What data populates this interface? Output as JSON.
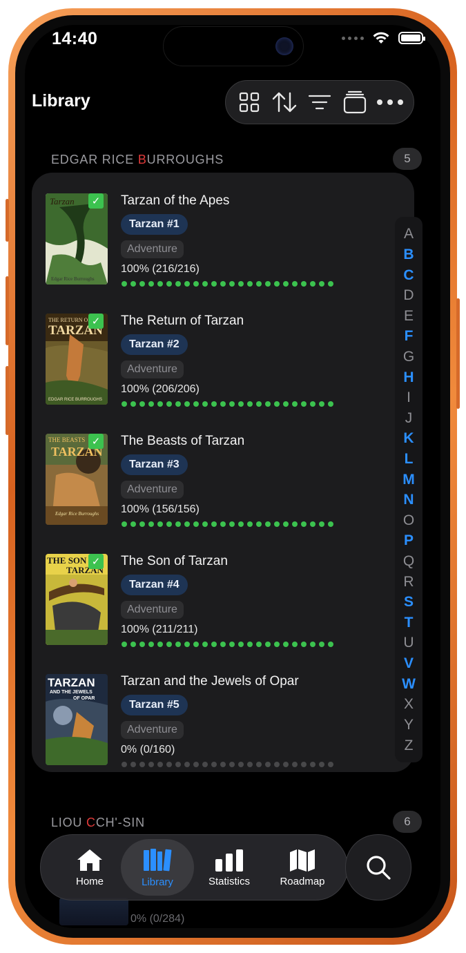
{
  "status": {
    "time": "14:40"
  },
  "header": {
    "title": "Library"
  },
  "toolbar": {
    "icons": [
      "grid-icon",
      "sort-icon",
      "filter-icon",
      "stack-icon",
      "more-icon"
    ]
  },
  "sections": [
    {
      "name_pre": "EDGAR RICE ",
      "name_hl": "B",
      "name_post": "URROUGHS",
      "count": "5"
    },
    {
      "name_pre": "LIOU ",
      "name_hl": "C",
      "name_post": "CH'-SIN",
      "count": "6"
    }
  ],
  "books": [
    {
      "title": "Tarzan of the Apes",
      "series": "Tarzan #1",
      "genre": "Adventure",
      "progress": "100% (216/216)",
      "progress_fraction": 1.0,
      "finished": true,
      "cover_text": "Tarzan"
    },
    {
      "title": "The Return of Tarzan",
      "series": "Tarzan #2",
      "genre": "Adventure",
      "progress": "100% (206/206)",
      "progress_fraction": 1.0,
      "finished": true,
      "cover_text": "THE RETURN OF TARZAN"
    },
    {
      "title": "The Beasts of Tarzan",
      "series": "Tarzan #3",
      "genre": "Adventure",
      "progress": "100% (156/156)",
      "progress_fraction": 1.0,
      "finished": true,
      "cover_text": "THE BEASTS OF TARZAN"
    },
    {
      "title": "The Son of Tarzan",
      "series": "Tarzan #4",
      "genre": "Adventure",
      "progress": "100% (211/211)",
      "progress_fraction": 1.0,
      "finished": true,
      "cover_text": "THE SON OF TARZAN"
    },
    {
      "title": "Tarzan and the Jewels of Opar",
      "series": "Tarzan #5",
      "genre": "Adventure",
      "progress": "0% (0/160)",
      "progress_fraction": 0.0,
      "finished": false,
      "cover_text": "TARZAN AND THE JEWELS OF OPAR"
    }
  ],
  "below": {
    "progress": "0% (0/284)"
  },
  "alphabet": [
    "A",
    "B",
    "C",
    "D",
    "E",
    "F",
    "G",
    "H",
    "I",
    "J",
    "K",
    "L",
    "M",
    "N",
    "O",
    "P",
    "Q",
    "R",
    "S",
    "T",
    "U",
    "V",
    "W",
    "X",
    "Y",
    "Z"
  ],
  "alphabet_active": [
    "B",
    "C",
    "F",
    "H",
    "K",
    "L",
    "M",
    "N",
    "P",
    "S",
    "T",
    "V",
    "W"
  ],
  "tabs": [
    {
      "label": "Home",
      "icon": "house-icon"
    },
    {
      "label": "Library",
      "icon": "books-icon",
      "active": true
    },
    {
      "label": "Statistics",
      "icon": "bar-chart-icon"
    },
    {
      "label": "Roadmap",
      "icon": "map-icon"
    }
  ],
  "colors": {
    "accent": "#2b8fff",
    "complete": "#3cc24f",
    "highlight_letter": "#e03a3a",
    "series_pill": "#1e3454"
  }
}
